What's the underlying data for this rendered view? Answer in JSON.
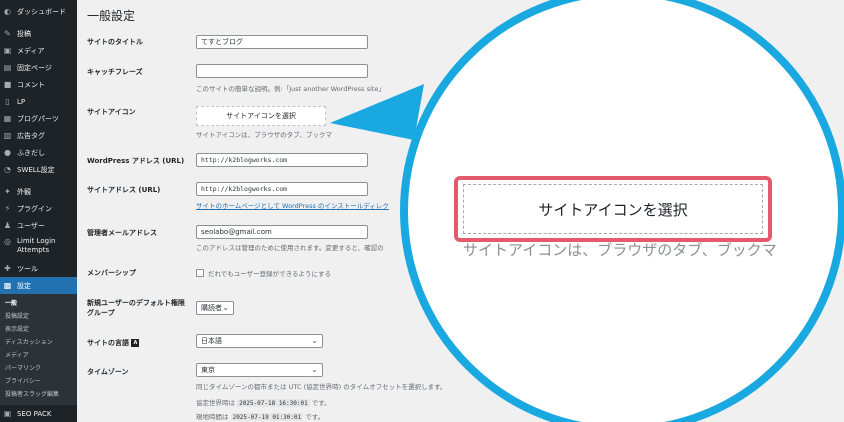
{
  "sidebar": {
    "items": [
      {
        "label": "ダッシュボード",
        "icon": "dashboard-icon",
        "glyph": "◐"
      },
      {
        "label": "投稿",
        "icon": "pin-icon",
        "glyph": "✎"
      },
      {
        "label": "メディア",
        "icon": "media-icon",
        "glyph": "▣"
      },
      {
        "label": "固定ページ",
        "icon": "page-icon",
        "glyph": "▤"
      },
      {
        "label": "コメント",
        "icon": "comment-icon",
        "glyph": "■"
      },
      {
        "label": "LP",
        "icon": "lp-icon",
        "glyph": "▯"
      },
      {
        "label": "ブログパーツ",
        "icon": "blog-parts-icon",
        "glyph": "▦"
      },
      {
        "label": "広告タグ",
        "icon": "ad-tag-icon",
        "glyph": "▥"
      },
      {
        "label": "ふきだし",
        "icon": "balloon-icon",
        "glyph": "●"
      },
      {
        "label": "SWELL設定",
        "icon": "swell-icon",
        "glyph": "◔"
      },
      {
        "label": "外観",
        "icon": "appearance-icon",
        "glyph": "✦"
      },
      {
        "label": "プラグイン",
        "icon": "plugin-icon",
        "glyph": "⚡"
      },
      {
        "label": "ユーザー",
        "icon": "user-icon",
        "glyph": "♟"
      },
      {
        "label": "Limit Login Attempts",
        "icon": "limit-login-icon",
        "glyph": "◎"
      },
      {
        "label": "ツール",
        "icon": "tool-icon",
        "glyph": "✚"
      },
      {
        "label": "設定",
        "icon": "settings-icon",
        "glyph": "▩"
      }
    ],
    "submenu": [
      "一般",
      "投稿設定",
      "表示設定",
      "ディスカッション",
      "メディア",
      "パーマリンク",
      "プライバシー",
      "投稿者スラッグ編集"
    ],
    "bottom": {
      "label": "SEO PACK",
      "icon": "seo-pack-icon",
      "glyph": "▣"
    }
  },
  "main": {
    "page_title": "一般設定",
    "site_title": {
      "label": "サイトのタイトル",
      "value": "てすとブログ"
    },
    "tagline": {
      "label": "キャッチフレーズ",
      "value": "",
      "desc": "このサイトの簡単な説明。例:「Just another WordPress site」"
    },
    "site_icon": {
      "label": "サイトアイコン",
      "button": "サイトアイコンを選択",
      "desc": "サイトアイコンは、ブラウザのタブ、ブックマ"
    },
    "wp_address": {
      "label": "WordPress アドレス (URL)",
      "value": "http://k2blogworks.com"
    },
    "site_address": {
      "label": "サイトアドレス (URL)",
      "value": "http://k2blogworks.com",
      "desc_link": "サイトのホームページとして WordPress のインストールディレク"
    },
    "admin_email": {
      "label": "管理者メールアドレス",
      "value": "seolabo@gmail.com",
      "desc": "このアドレスは管理のために使用されます。変更すると、確認の"
    },
    "membership": {
      "label": "メンバーシップ",
      "checkbox_label": "だれでもユーザー登録ができるようにする"
    },
    "default_role": {
      "label_line1": "新規ユーザーのデフォルト権限",
      "label_line2": "グループ",
      "value": "購読者"
    },
    "site_language": {
      "label": "サイトの言語",
      "value": "日本語"
    },
    "timezone": {
      "label": "タイムゾーン",
      "value": "東京",
      "desc": "同じタイムゾーンの都市または UTC (協定世界時) のタイムオフセットを選択します。",
      "utc_label": "協定世界時は",
      "utc_value": "2025-07-18 16:30:01",
      "utc_suffix": "です。",
      "local_label": "現地時間は",
      "local_value": "2025-07-19 01:30:01",
      "local_suffix": "です。"
    }
  },
  "zoom": {
    "button": "サイトアイコンを選択",
    "desc": "サイトアイコンは、ブラウザのタブ、ブックマ"
  },
  "colors": {
    "sidebar_bg": "#1d2327",
    "active": "#2271b1",
    "callout_border": "#19a8e0",
    "highlight": "#e35a6c"
  }
}
